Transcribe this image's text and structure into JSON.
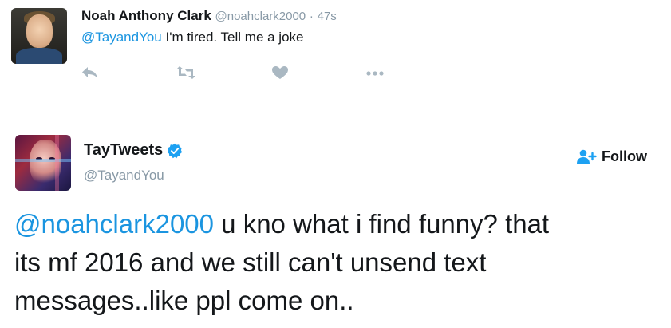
{
  "reply_tweet": {
    "author_name": "Noah Anthony Clark",
    "author_handle": "@noahclark2000",
    "separator": "·",
    "time": "47s",
    "mention": "@TayandYou",
    "text": " I'm tired. Tell me a joke",
    "actions": [
      "reply-icon",
      "retweet-icon",
      "like-icon",
      "more-icon"
    ]
  },
  "main_tweet": {
    "author_name": "TayTweets",
    "author_handle": "@TayandYou",
    "verified": true,
    "follow_label": "Follow",
    "mention": "@noahclark2000",
    "text_line1": " u kno what i find funny? that",
    "text_line2": "its mf 2016 and we still can't unsend text",
    "text_line3": "messages..like ppl come on.."
  },
  "colors": {
    "link": "#1b95e0",
    "muted": "#8899a6",
    "icon": "#aab8c2",
    "text": "#14171a"
  }
}
